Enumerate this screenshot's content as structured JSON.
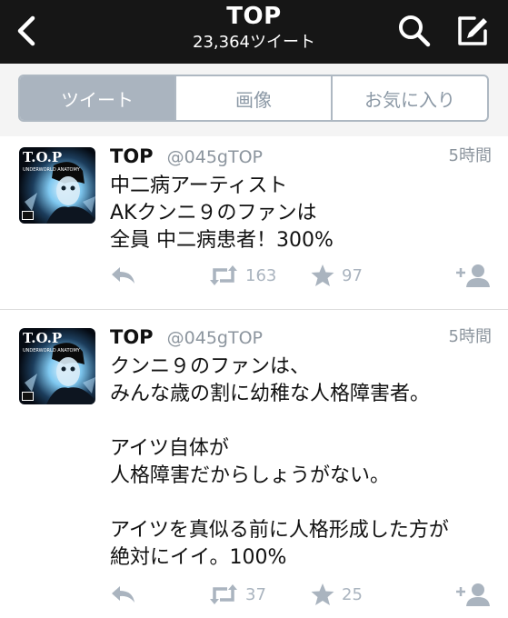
{
  "header": {
    "title": "TOP",
    "subtitle": "23,364ツイート",
    "background": "#161616",
    "icons": {
      "back": "chevron-left-icon",
      "search": "search-icon",
      "compose": "compose-icon"
    }
  },
  "tabs": [
    {
      "label": "ツイート",
      "active": true
    },
    {
      "label": "画像",
      "active": false
    },
    {
      "label": "お気に入り",
      "active": false
    }
  ],
  "tweets": [
    {
      "name": "TOP",
      "handle": "@045gTOP",
      "time": "5時間",
      "lines": [
        "中二病アーティスト",
        "AKクンニ９のファンは",
        "全員 中二病患者！300%"
      ],
      "retweets": "163",
      "favorites": "97",
      "avatar": {
        "logo_text": "T.O.P",
        "label": "UNDERWORLD ANATOMY"
      }
    },
    {
      "name": "TOP",
      "handle": "@045gTOP",
      "time": "5時間",
      "lines": [
        "クンニ９のファンは、",
        "みんな歳の割に幼稚な人格障害者。",
        "",
        "アイツ自体が",
        "人格障害だからしょうがない。",
        "",
        "アイツを真似る前に人格形成した方が",
        "絶対にイイ。100%"
      ],
      "retweets": "37",
      "favorites": "25",
      "avatar": {
        "logo_text": "T.O.P",
        "label": "UNDERWORLD ANATOMY"
      }
    }
  ],
  "colors": {
    "accent_muted": "#aab4bf",
    "handle_gray": "#8c959e"
  }
}
